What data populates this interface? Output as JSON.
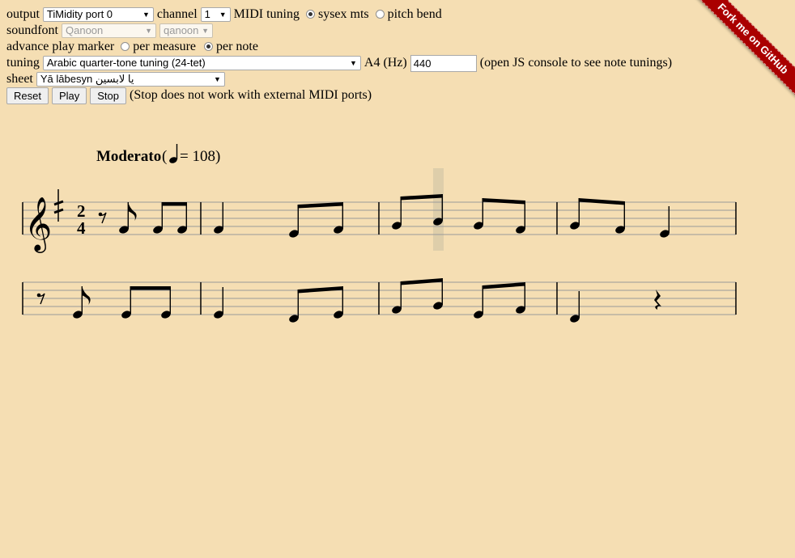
{
  "controls": {
    "output_label": "output",
    "output_value": "TiMidity port 0",
    "channel_label": "channel",
    "channel_value": "1",
    "midi_tuning_label": "MIDI tuning",
    "sysex_label": "sysex mts",
    "pitch_bend_label": "pitch bend",
    "midi_tuning_selected": "sysex mts",
    "soundfont_label": "soundfont",
    "soundfont_value": "Qanoon",
    "soundfont_preset_value": "qanoon",
    "advance_label": "advance play marker",
    "per_measure_label": "per measure",
    "per_note_label": "per note",
    "advance_selected": "per note",
    "tuning_label": "tuning",
    "tuning_value": "Arabic quarter-tone tuning (24-tet)",
    "a4_label": "A4 (Hz)",
    "a4_value": "440",
    "tuning_note": "(open JS console to see note tunings)",
    "sheet_label": "sheet",
    "sheet_value": "Yā lābesyn يا لابسين",
    "reset_label": "Reset",
    "play_label": "Play",
    "stop_label": "Stop",
    "stop_note": "(Stop does not work with external MIDI ports)"
  },
  "ribbon": {
    "text": "Fork me on GitHub",
    "color": "#aa0000"
  },
  "score": {
    "tempo_text": "Moderato",
    "tempo_value": "= 108)",
    "tempo_open": "(",
    "time_signature": {
      "top": "2",
      "bottom": "4"
    },
    "clef": "treble-clef",
    "key_signature": "half-sharp",
    "background_color": "#f5deb3",
    "play_marker_position": "measure 3, note 2"
  }
}
